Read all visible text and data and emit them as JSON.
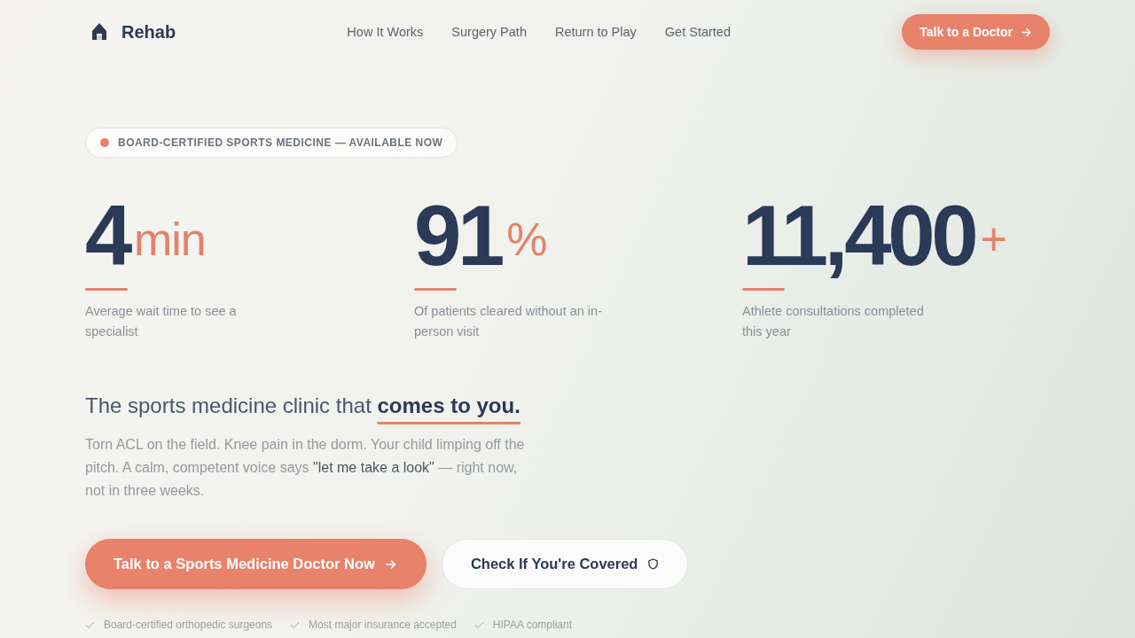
{
  "header": {
    "brand": "Rehab",
    "nav": [
      {
        "label": "How It Works"
      },
      {
        "label": "Surgery Path"
      },
      {
        "label": "Return to Play"
      },
      {
        "label": "Get Started"
      }
    ],
    "cta": {
      "label": "Talk to a Doctor"
    }
  },
  "hero": {
    "badge": "BOARD-CERTIFIED SPORTS MEDICINE — AVAILABLE NOW",
    "stats": [
      {
        "value": "4",
        "unit": "min",
        "description": "Average wait time to see a specialist"
      },
      {
        "value": "91",
        "unit": "%",
        "description": "Of patients cleared without an in-person visit"
      },
      {
        "value": "11,400",
        "unit": "+",
        "description": "Athlete consultations completed this year"
      }
    ],
    "headline": "The sports medicine clinic that **comes to you.**",
    "intro": [
      {
        "text": "Torn ACL on the field. Knee pain in the dorm. Your child limping off the pitch. A calm, competent voice says ",
        "highlight": false
      },
      {
        "text": "\"let me take a look\"",
        "highlight": true
      },
      {
        "text": " — right now, not in three weeks.",
        "highlight": false
      }
    ],
    "buttons": [
      {
        "kind": "primary",
        "label": "Talk to a Sports Medicine Doctor Now"
      },
      {
        "kind": "secondary",
        "label": "Check If You're Covered"
      }
    ],
    "trust_items": [
      "Board-certified orthopedic surgeons",
      "Most major insurance accepted",
      "HIPAA compliant"
    ]
  }
}
